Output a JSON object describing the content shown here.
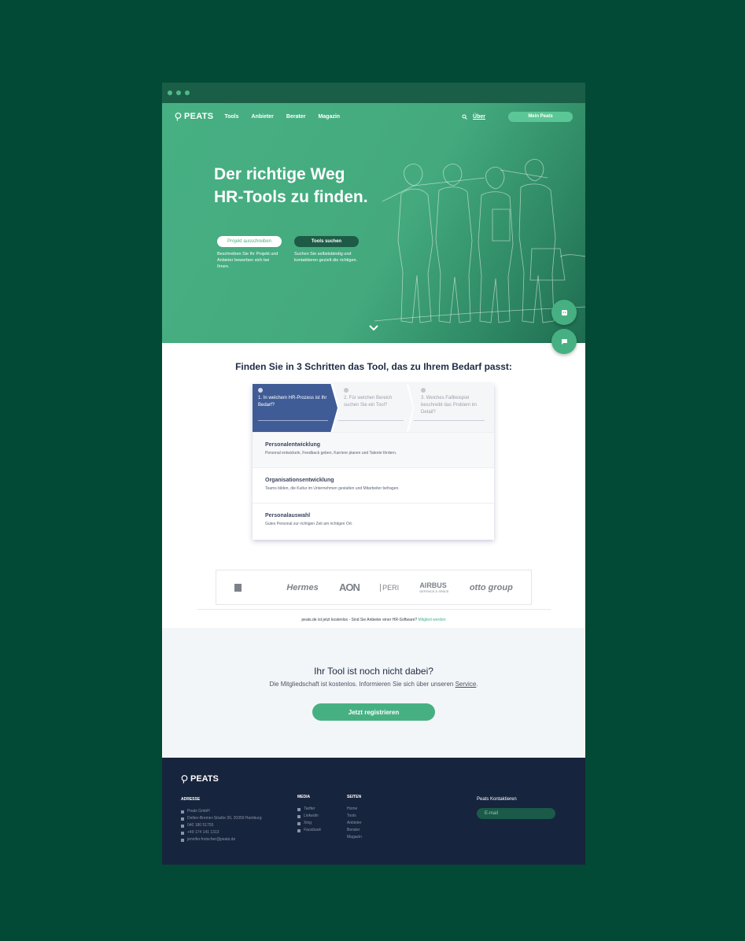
{
  "nav": {
    "logo": "PEATS",
    "links": [
      "Tools",
      "Anbieter",
      "Berater",
      "Magazin"
    ],
    "about": "Über",
    "account_button": "Mein Peats"
  },
  "hero": {
    "title_line1": "Der richtige Weg",
    "title_line2": "HR-Tools zu finden.",
    "cta1": {
      "label": "Projekt ausschreiben",
      "text": "Beschreiben Sie Ihr Projekt und Anbieter bewerben sich bei Ihnen."
    },
    "cta2": {
      "label": "Tools suchen",
      "text": "Suchen Sie selbstständig und kontaktieren gezielt die richtigen."
    }
  },
  "steps": {
    "heading": "Finden Sie in 3 Schritten das Tool, das zu Ihrem Bedarf passt:",
    "items": [
      {
        "label": "1. In welchem HR-Prozess ist Ihr Bedarf?"
      },
      {
        "label": "2. Für welchen Bereich suchen Sie ein Tool?"
      },
      {
        "label": "3. Welches Fallbeispiel beschreibt das Problem im Detail?"
      }
    ],
    "options": [
      {
        "title": "Personalentwicklung",
        "desc": "Personal entwickeln, Feedback geben, Karriere planen und Talente fördern."
      },
      {
        "title": "Organisationsentwicklung",
        "desc": "Teams bilden, die Kultur im Unternehmen gestalten und Mitarbeiter befragen."
      },
      {
        "title": "Personalauswahl",
        "desc": "Gutes Personal zur richtigen Zeit am richtigen Ort."
      }
    ]
  },
  "logos": {
    "hermes": "Hermes",
    "aon": "AON",
    "peri": "PERI",
    "airbus": "AIRBUS",
    "airbus_sub": "DEFENCE & SPACE",
    "otto": "otto group"
  },
  "free_note": {
    "text": "peats.de ist jetzt kostenlos - Sind Sie Anbieter einer HR-Software?",
    "link": "Mitglied werden"
  },
  "register": {
    "title": "Ihr Tool ist noch nicht dabei?",
    "text": "Die Mitgliedschaft ist kostenlos. Informieren Sie sich über unseren",
    "link": "Service",
    "button": "Jetzt registrieren"
  },
  "footer": {
    "logo": "PEATS",
    "address_title": "ADRESSE",
    "company": "Peats GmbH",
    "street": "Detlev-Bremer-Straße 30, 20359 Hamburg",
    "phone1": "040 180 51755",
    "phone2": "+49 174 141 1313",
    "email": "jennifer.frotscher@peats.de",
    "media_title": "MEDIA",
    "media": [
      "Twitter",
      "Linkedin",
      "Xing",
      "Facebook"
    ],
    "pages_title": "SEITEN",
    "pages": [
      "Home",
      "Tools",
      "Anbieter",
      "Berater",
      "Magazin"
    ],
    "contact_title": "Peats Kontaktieren",
    "email_placeholder": "E-mail"
  },
  "colors": {
    "brand_green": "#47b083",
    "navy": "#17243d",
    "step_active": "#3f5c97",
    "background": "#024a35"
  }
}
